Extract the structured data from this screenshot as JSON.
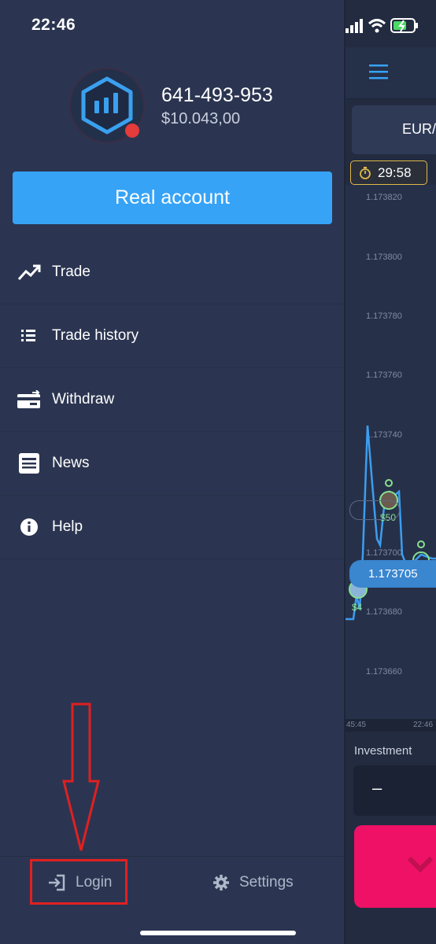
{
  "status_bar": {
    "time": "22:46"
  },
  "account": {
    "number": "641-493-953",
    "balance": "$10.043,00",
    "type_button": "Real account"
  },
  "menu": [
    {
      "label": "Trade",
      "icon": "trend-up-icon"
    },
    {
      "label": "Trade history",
      "icon": "list-icon"
    },
    {
      "label": "Withdraw",
      "icon": "card-transfer-icon"
    },
    {
      "label": "News",
      "icon": "newspaper-icon"
    },
    {
      "label": "Help",
      "icon": "info-icon"
    }
  ],
  "footer": {
    "login": "Login",
    "settings": "Settings"
  },
  "background": {
    "pair": "EUR/",
    "timer": "29:58",
    "price_ticks": [
      "1.173820",
      "1.173800",
      "1.173780",
      "1.173760",
      "1.173740",
      "1.173700",
      "1.173680",
      "1.173660"
    ],
    "current_price": "1.173705",
    "time_start": "45:45",
    "time_end": "22:46",
    "investment_label": "Investment",
    "investment_value": "–",
    "trade_amounts": [
      "$50",
      "$1",
      "$4"
    ]
  },
  "colors": {
    "accent_blue": "#36a3f7",
    "sell_pink": "#ee1166",
    "annotation_red": "#e02020"
  }
}
